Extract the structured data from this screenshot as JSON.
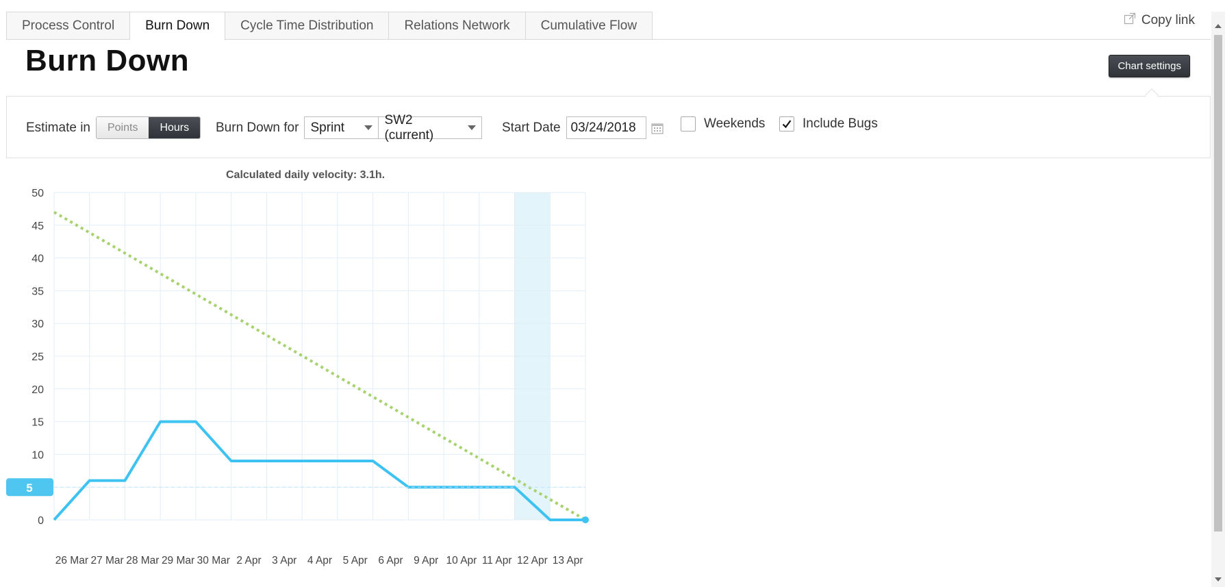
{
  "tabs": [
    {
      "label": "Process Control",
      "active": false
    },
    {
      "label": "Burn Down",
      "active": true
    },
    {
      "label": "Cycle Time Distribution",
      "active": false
    },
    {
      "label": "Relations Network",
      "active": false
    },
    {
      "label": "Cumulative Flow",
      "active": false
    }
  ],
  "copy_link_label": "Copy link",
  "page_title": "Burn Down",
  "chart_settings_label": "Chart settings",
  "settings": {
    "estimate_label": "Estimate in",
    "estimate_options": [
      "Points",
      "Hours"
    ],
    "estimate_selected": "Hours",
    "burn_down_for_label": "Burn Down for",
    "scope_type": "Sprint",
    "sprint": "SW2 (current)",
    "start_date_label": "Start Date",
    "start_date": "03/24/2018",
    "weekends_label": "Weekends",
    "weekends_checked": false,
    "include_bugs_label": "Include Bugs",
    "include_bugs_checked": true
  },
  "colors": {
    "actual_line": "#3ec2f2",
    "ideal_line": "#a7d26e",
    "highlight_band": "#e3f4fb",
    "grid": "#e2eef6",
    "marker_badge": "#4fc6f0"
  },
  "chart_data": {
    "type": "line",
    "title": "Calculated daily velocity: 3.1h.",
    "categories": [
      "26 Mar",
      "27 Mar",
      "28 Mar",
      "29 Mar",
      "30 Mar",
      "2 Apr",
      "3 Apr",
      "4 Apr",
      "5 Apr",
      "6 Apr",
      "9 Apr",
      "10 Apr",
      "11 Apr",
      "12 Apr",
      "13 Apr"
    ],
    "ylim": [
      0,
      50
    ],
    "yticks": [
      0,
      5,
      10,
      15,
      20,
      25,
      30,
      35,
      40,
      45,
      50
    ],
    "grid": true,
    "series": [
      {
        "values": [
          0,
          6,
          6,
          15,
          15,
          9,
          9,
          9,
          9,
          9,
          5,
          5,
          5,
          5,
          0,
          0
        ]
      },
      {
        "values": [
          47,
          0
        ]
      }
    ],
    "actual_x_index": [
      0,
      1,
      2,
      3,
      4,
      5,
      6,
      7,
      8,
      9,
      10,
      11,
      12,
      13,
      14,
      15
    ],
    "highlight_category": "12 Apr",
    "marker_value": 5
  }
}
